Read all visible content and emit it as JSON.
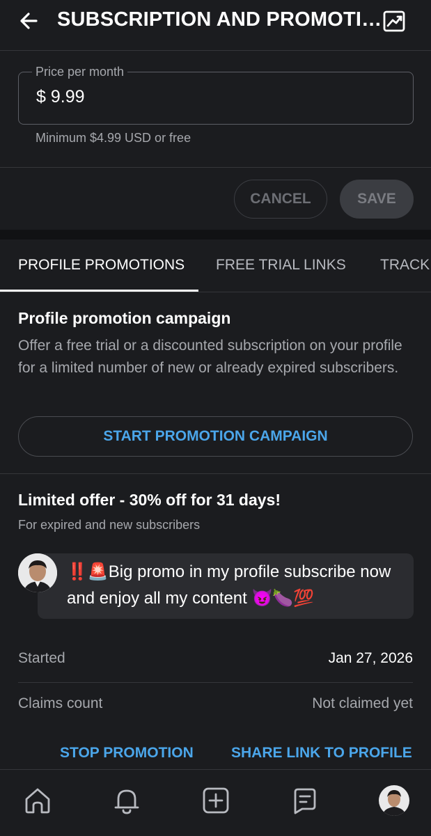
{
  "header": {
    "title": "SUBSCRIPTION AND PROMOTI…"
  },
  "price": {
    "label": "Price per month",
    "value": "$ 9.99",
    "helper": "Minimum $4.99 USD or free"
  },
  "actions": {
    "cancel": "CANCEL",
    "save": "SAVE"
  },
  "tabs": [
    {
      "label": "PROFILE PROMOTIONS",
      "active": true
    },
    {
      "label": "FREE TRIAL LINKS",
      "active": false
    },
    {
      "label": "TRACKI",
      "active": false
    }
  ],
  "promotion": {
    "title": "Profile promotion campaign",
    "description": "Offer a free trial or a discounted subscription on your profile for a limited number of new or already expired subscribers.",
    "start_button": "START PROMOTION CAMPAIGN"
  },
  "offer": {
    "title": "Limited offer - 30% off for 31 days!",
    "subtitle": "For expired and new subscribers",
    "message_emoji_prefix": "‼️🚨",
    "message": "Big promo in my profile subscribe now and enjoy all my content",
    "message_emoji_suffix": "😈🍆💯",
    "started_label": "Started",
    "started_value": "Jan 27, 2026",
    "claims_label": "Claims count",
    "claims_value": "Not claimed yet",
    "stop_button": "STOP PROMOTION",
    "share_button": "SHARE LINK TO PROFILE"
  },
  "bottom_nav": [
    {
      "icon": "home-icon"
    },
    {
      "icon": "bell-icon"
    },
    {
      "icon": "add-post-icon"
    },
    {
      "icon": "messages-icon"
    },
    {
      "icon": "profile-avatar"
    }
  ],
  "colors": {
    "background": "#1b1c1f",
    "accent": "#4ba6ea",
    "muted_text": "#a6a8ad"
  }
}
